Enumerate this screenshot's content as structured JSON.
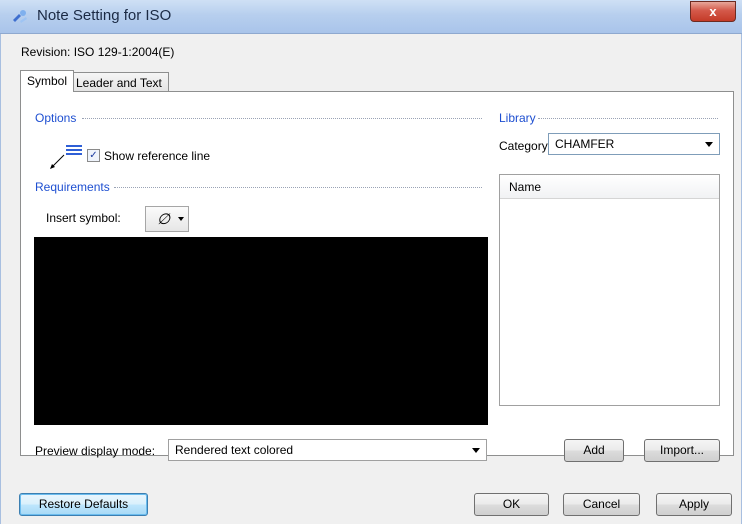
{
  "window": {
    "title": "Note Setting for ISO",
    "close_glyph": "x"
  },
  "revision": "Revision: ISO 129-1:2004(E)",
  "tabs": [
    {
      "label": "Symbol",
      "active": true
    },
    {
      "label": "Leader and Text",
      "active": false
    }
  ],
  "options": {
    "title": "Options",
    "show_reference_line_label": "Show reference line",
    "show_reference_line_checked": true,
    "checkbox_glyph": "✓"
  },
  "requirements": {
    "title": "Requirements",
    "insert_symbol_label": "Insert symbol:",
    "insert_symbol_glyph": "∅"
  },
  "preview": {
    "mode_label": "Preview display mode:",
    "mode_value": "Rendered text colored"
  },
  "library": {
    "title": "Library",
    "category_label": "Category:",
    "category_value": "CHAMFER",
    "list_header": "Name",
    "add_label": "Add",
    "import_label": "Import..."
  },
  "footer": {
    "restore_label": "Restore Defaults",
    "ok_label": "OK",
    "cancel_label": "Cancel",
    "apply_label": "Apply"
  },
  "colors": {
    "section_title": "#1e4fd1",
    "preview_background": "#000000"
  }
}
